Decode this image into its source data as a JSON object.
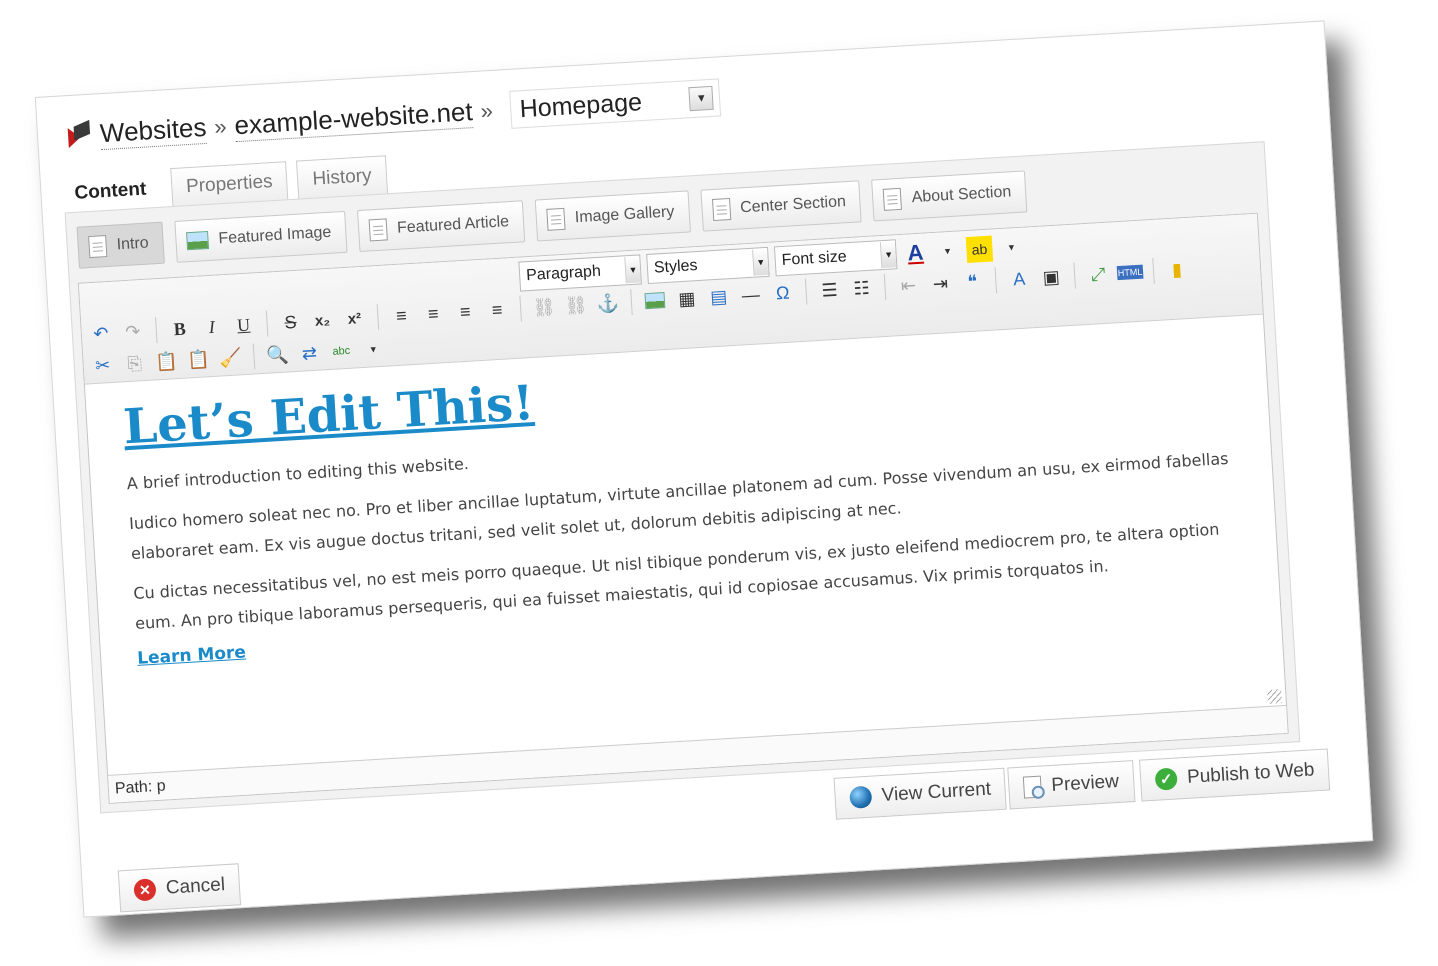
{
  "breadcrumb": {
    "root": "Websites",
    "sep1": "»",
    "site": "example-website.net",
    "sep2": "»",
    "page_value": "Homepage"
  },
  "tabs": [
    {
      "label": "Content"
    },
    {
      "label": "Properties"
    },
    {
      "label": "History"
    }
  ],
  "sections": [
    {
      "label": "Intro"
    },
    {
      "label": "Featured Image"
    },
    {
      "label": "Featured Article"
    },
    {
      "label": "Image Gallery"
    },
    {
      "label": "Center Section"
    },
    {
      "label": "About Section"
    }
  ],
  "toolbar": {
    "format_select": "Paragraph",
    "styles_select": "Styles",
    "fontsize_select": "Font size",
    "icons": {
      "undo": "↶",
      "redo": "↷",
      "bold": "B",
      "italic": "I",
      "underline": "U",
      "strike": "S",
      "subscript": "x₂",
      "superscript": "x²",
      "align_left": "≡",
      "align_center": "≡",
      "align_right": "≡",
      "align_justify": "≡",
      "text_color": "A",
      "highlight": "ab",
      "cut": "✂",
      "copy": "⎘",
      "paste": "📋",
      "paste_text": "📋",
      "cleanup": "🧹",
      "find": "🔍",
      "replace": "⇄",
      "spellcheck": "abc",
      "link": "⛓",
      "unlink": "⛓",
      "anchor": "⚓",
      "hr": "—",
      "omega": "Ω",
      "bullets": "☰",
      "numbers": "☷",
      "outdent": "⇤",
      "indent": "⇥",
      "quote": "❝",
      "fullscreen": "⤢",
      "html": "HTML"
    }
  },
  "editor": {
    "heading": "Let’s Edit This!",
    "paragraphs": [
      "A brief introduction to editing this website.",
      "Iudico homero soleat nec no. Pro et liber ancillae luptatum, virtute ancillae platonem ad cum. Posse vivendum an usu, ex eirmod fabellas elaboraret eam. Ex vis augue doctus tritani, sed velit solet ut, dolorum debitis adipiscing at nec.",
      "Cu dictas necessitatibus vel, no est meis porro quaeque. Ut nisl tibique ponderum vis, ex justo eleifend mediocrem pro, te altera option eum. An pro tibique laboramus persequeris, qui ea fuisset maiestatis, qui id copiosae accusamus. Vix primis torquatos in."
    ],
    "learn_more": "Learn More",
    "path": "Path: p"
  },
  "actions": {
    "view_current": "View Current",
    "preview": "Preview",
    "publish": "Publish to Web",
    "cancel": "Cancel"
  },
  "colors": {
    "link": "#1a8ac9",
    "card_border": "#d6d6d6",
    "cancel": "#d9302c",
    "publish": "#3cae3c"
  }
}
